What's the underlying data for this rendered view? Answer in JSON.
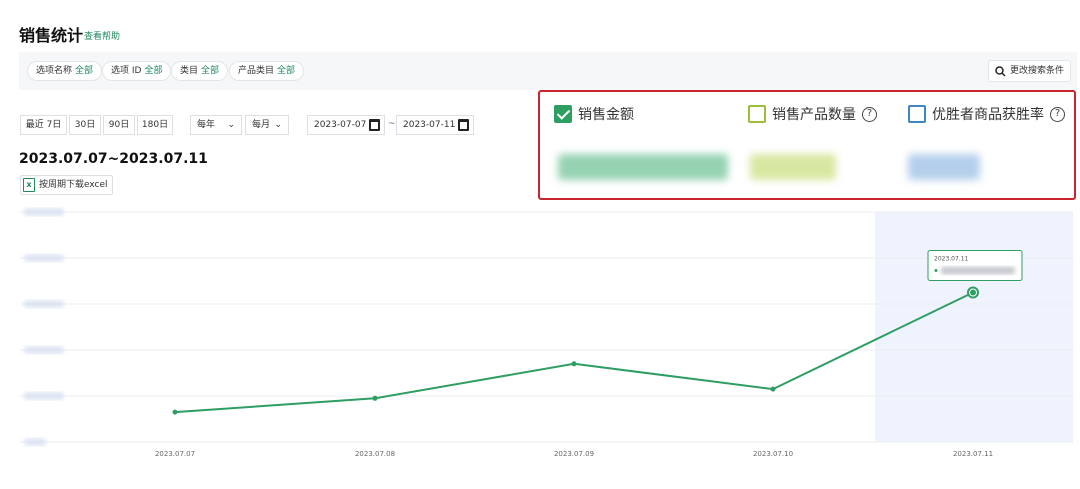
{
  "page": {
    "title": "销售统计",
    "help_link": "查看帮助"
  },
  "filters": {
    "chips": [
      {
        "label": "选项名称",
        "value": "全部"
      },
      {
        "label": "选项 ID",
        "value": "全部"
      },
      {
        "label": "类目",
        "value": "全部"
      },
      {
        "label": "产品类目",
        "value": "全部"
      }
    ],
    "change_button": "更改搜索条件"
  },
  "period": {
    "segments": [
      "最近 7日",
      "30日",
      "90日",
      "180日"
    ],
    "year_select": "每年",
    "month_select": "每月",
    "start_date": "2023-07-07",
    "end_date": "2023-07-11",
    "separator": "~"
  },
  "range_title": "2023.07.07~2023.07.11",
  "excel_button": "按周期下载excel",
  "metrics": [
    {
      "label": "销售金额",
      "checked": true,
      "has_help": false,
      "color": "#2e9e62"
    },
    {
      "label": "销售产品数量",
      "checked": false,
      "has_help": true,
      "color": "#9bbe3c"
    },
    {
      "label": "优胜者商品获胜率",
      "checked": false,
      "has_help": true,
      "color": "#3e86c5"
    }
  ],
  "chart_data": {
    "type": "line",
    "categories": [
      "2023.07.07",
      "2023.07.08",
      "2023.07.09",
      "2023.07.10",
      "2023.07.11"
    ],
    "series": [
      {
        "values": [
          0.13,
          0.19,
          0.34,
          0.23,
          0.65
        ]
      }
    ],
    "y_normalized": true,
    "ylim": [
      0,
      1
    ],
    "grid": true,
    "highlight_category": "2023.07.11",
    "tooltip": {
      "title": "2023.07.11"
    },
    "line_color": "#2e9e62",
    "highlight_color": "#eef3fd"
  }
}
